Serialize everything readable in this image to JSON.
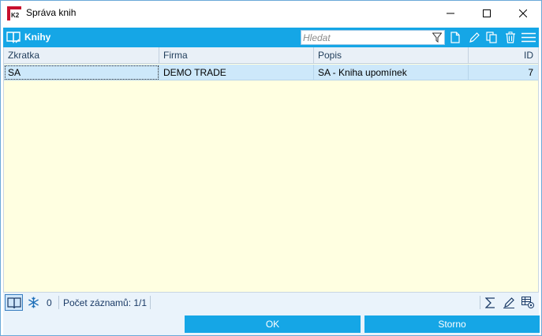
{
  "window": {
    "title": "Správa knih"
  },
  "toolbar": {
    "title": "Knihy",
    "search_placeholder": "Hledat",
    "search_value": ""
  },
  "grid": {
    "columns": [
      {
        "label": "Zkratka"
      },
      {
        "label": "Firma"
      },
      {
        "label": "Popis"
      },
      {
        "label": "ID"
      }
    ],
    "rows": [
      {
        "zkratka": "SA",
        "firma": "DEMO TRADE",
        "popis": "SA - Kniha upomínek",
        "id": "7"
      }
    ]
  },
  "statusbar": {
    "filter_count": "0",
    "record_count": "Počet záznamů: 1/1"
  },
  "footer": {
    "ok_label": "OK",
    "cancel_label": "Storno"
  },
  "colors": {
    "accent": "#15a6e6",
    "grid_background": "#ffffe1",
    "selected_row": "#cde8fa"
  }
}
